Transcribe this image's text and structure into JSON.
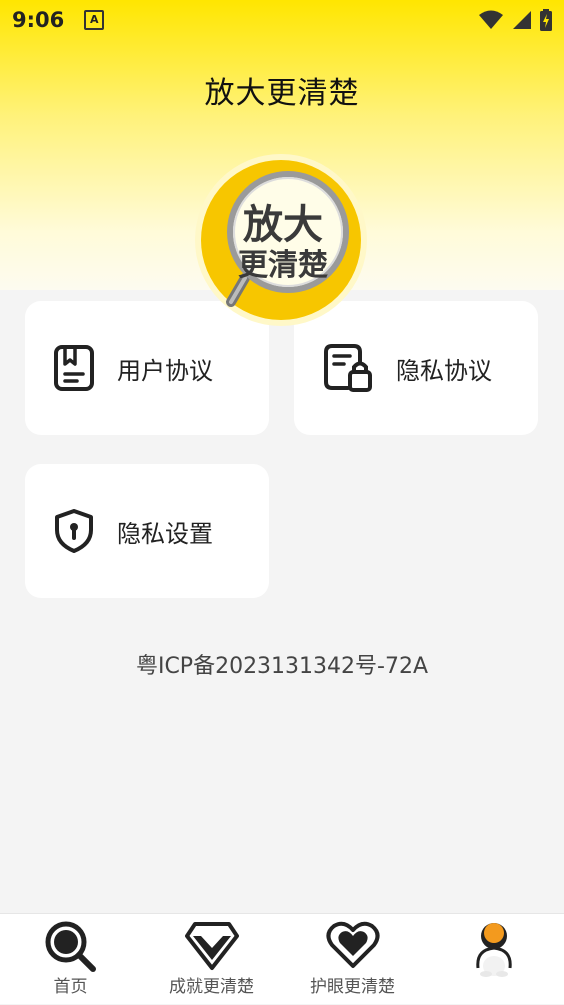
{
  "status_bar": {
    "time": "9:06",
    "notification": "A"
  },
  "header": {
    "title": "放大更清楚"
  },
  "logo": {
    "line1": "放大",
    "line2": "更清楚"
  },
  "menu": [
    {
      "label": "用户协议",
      "icon": "agreement-book-icon"
    },
    {
      "label": "隐私协议",
      "icon": "privacy-lock-document-icon"
    },
    {
      "label": "隐私设置",
      "icon": "shield-lock-icon"
    }
  ],
  "footer": {
    "icp": "粤ICP备2023131342号-72A"
  },
  "tabs": [
    {
      "label": "首页",
      "icon": "magnifier-icon"
    },
    {
      "label": "成就更清楚",
      "icon": "diamond-icon"
    },
    {
      "label": "护眼更清楚",
      "icon": "heart-icon"
    },
    {
      "label": "",
      "icon": "avatar-icon",
      "active": true
    }
  ],
  "colors": {
    "accent": "#ffe600",
    "logo_yellow": "#f7c600",
    "text": "#222222"
  }
}
